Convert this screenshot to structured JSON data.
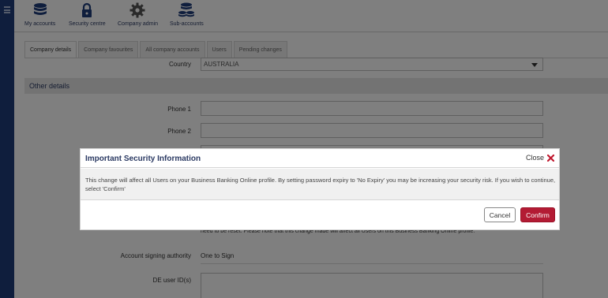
{
  "nav": {
    "items": [
      {
        "label": "My accounts"
      },
      {
        "label": "Security centre"
      },
      {
        "label": "Company admin"
      },
      {
        "label": "Sub-accounts"
      }
    ]
  },
  "tabs": [
    {
      "label": "Company details"
    },
    {
      "label": "Company favourites"
    },
    {
      "label": "All company accounts"
    },
    {
      "label": "Users"
    },
    {
      "label": "Pending changes"
    }
  ],
  "form": {
    "country_label": "Country",
    "country_value": "AUSTRALIA",
    "section_title": "Other details",
    "phone1_label": "Phone 1",
    "phone2_label": "Phone 2",
    "note_text": "need to be reset. Please note that this change made will affect all Users on this Business Banking Online profile.",
    "signing_label": "Account signing authority",
    "signing_value": "One to Sign",
    "de_label": "DE user ID(s)"
  },
  "modal": {
    "title": "Important Security Information",
    "close_label": "Close",
    "message": "This change will affect all Users on your Business Banking Online profile. By setting password expiry to 'No Expiry' you may be increasing your security risk. If you wish to continue, select 'Confirm'",
    "cancel_label": "Cancel",
    "confirm_label": "Confirm"
  },
  "colors": {
    "brand_navy": "#1f3d7a",
    "confirm_red": "#b31b34",
    "close_red": "#c0192f"
  }
}
